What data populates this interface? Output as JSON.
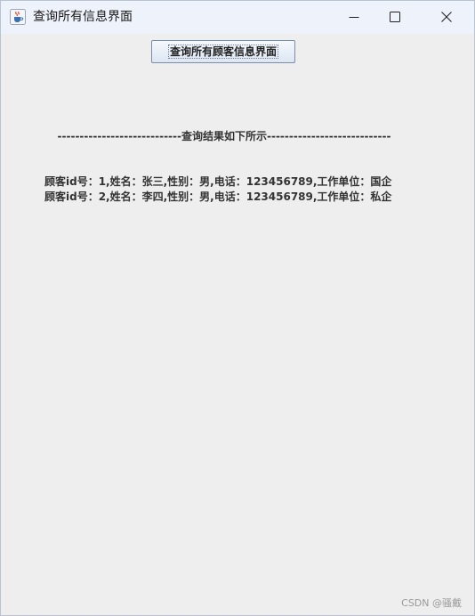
{
  "window": {
    "title": "查询所有信息界面",
    "app_icon": "java-cup-icon"
  },
  "toolbar": {
    "query_all_button_label": "查询所有顾客信息界面"
  },
  "results": {
    "divider_text": "----------------------------查询结果如下所示----------------------------",
    "rows": [
      "顾客id号：1,姓名：张三,性别：男,电话：123456789,工作单位：国企",
      "顾客id号：2,姓名：李四,性别：男,电话：123456789,工作单位：私企"
    ]
  },
  "watermark": "CSDN @骚戴"
}
